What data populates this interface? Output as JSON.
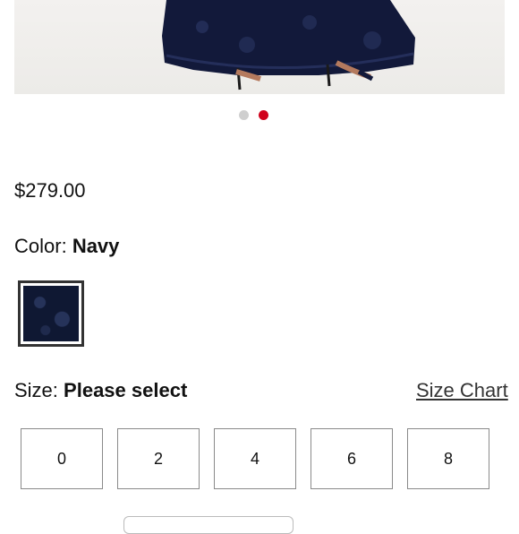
{
  "pagination": {
    "count": 2,
    "active_index": 1,
    "active_color": "#d0021b"
  },
  "product": {
    "price": "$279.00",
    "color_label": "Color:",
    "color_value": "Navy",
    "swatch_color": "#0f1833"
  },
  "size": {
    "label": "Size:",
    "value": "Please select",
    "chart_link": "Size Chart",
    "options": [
      "0",
      "2",
      "4",
      "6",
      "8"
    ]
  }
}
